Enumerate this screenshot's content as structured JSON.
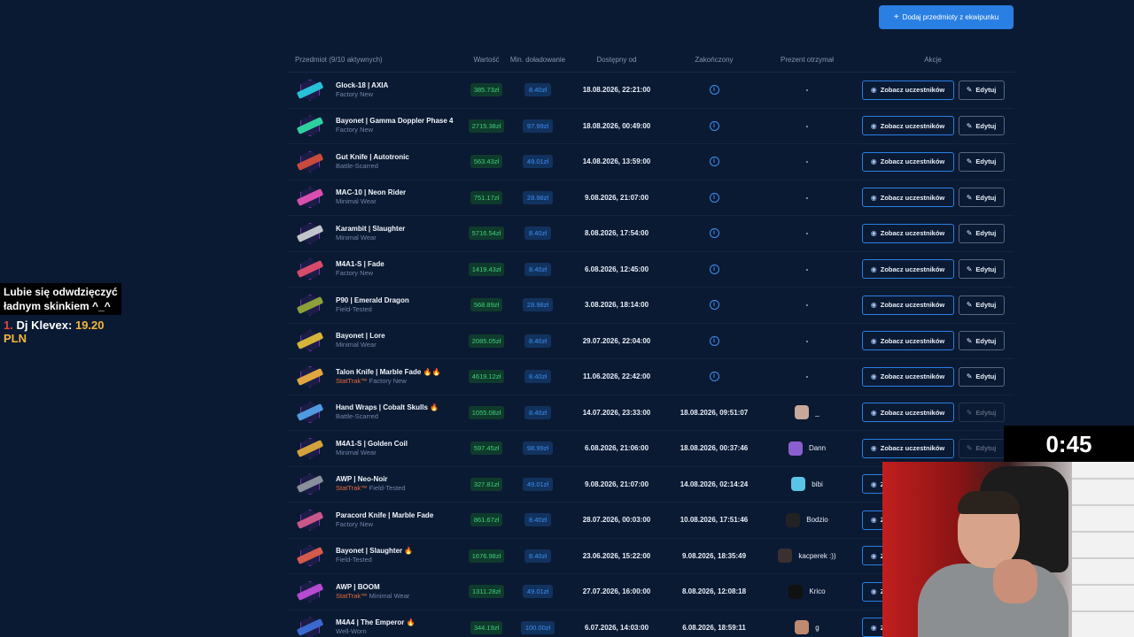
{
  "header": {
    "add_button_label": "Dodaj przedmioty z ekwipunku",
    "add_button_icon": "+"
  },
  "table": {
    "headers": {
      "item": "Przedmiot (9/10 aktywnych)",
      "value": "Wartość",
      "min_deposit": "Min. doładowanie",
      "available_from": "Dostępny od",
      "ended": "Zakończony",
      "gift_received": "Prezent otrzymał",
      "actions": "Akcje"
    },
    "view_label": "Zobacz uczestników",
    "edit_label": "Edytuj",
    "rows": [
      {
        "name": "Glock-18 | AXIA",
        "stattrak": "",
        "condition": "Factory New",
        "fire": "",
        "value": "385.73zł",
        "min": "8.40zł",
        "from": "18.08.2026, 22:21:00",
        "ended": "",
        "gift": "-",
        "gift_color": "",
        "edit_disabled": false,
        "color": "#27c0d6"
      },
      {
        "name": "Bayonet | Gamma Doppler Phase 4",
        "stattrak": "",
        "condition": "Factory New",
        "fire": "",
        "value": "2715.38zł",
        "min": "97.99zł",
        "from": "18.08.2026, 00:49:00",
        "ended": "",
        "gift": "-",
        "gift_color": "",
        "edit_disabled": false,
        "color": "#2fd0a0"
      },
      {
        "name": "Gut Knife | Autotronic",
        "stattrak": "",
        "condition": "Battle-Scarred",
        "fire": "",
        "value": "563.43zł",
        "min": "49.01zł",
        "from": "14.08.2026, 13:59:00",
        "ended": "",
        "gift": "-",
        "gift_color": "",
        "edit_disabled": false,
        "color": "#c94a3c"
      },
      {
        "name": "MAC-10 | Neon Rider",
        "stattrak": "",
        "condition": "Minimal Wear",
        "fire": "",
        "value": "751.17zł",
        "min": "28.98zł",
        "from": "9.08.2026, 21:07:00",
        "ended": "",
        "gift": "-",
        "gift_color": "",
        "edit_disabled": false,
        "color": "#d94fb0"
      },
      {
        "name": "Karambit | Slaughter",
        "stattrak": "",
        "condition": "Minimal Wear",
        "fire": "",
        "value": "5716.54zł",
        "min": "8.40zł",
        "from": "8.08.2026, 17:54:00",
        "ended": "",
        "gift": "-",
        "gift_color": "",
        "edit_disabled": false,
        "color": "#c2c6cc"
      },
      {
        "name": "M4A1-S | Fade",
        "stattrak": "",
        "condition": "Factory New",
        "fire": "",
        "value": "1419.43zł",
        "min": "8.40zł",
        "from": "6.08.2026, 12:45:00",
        "ended": "",
        "gift": "-",
        "gift_color": "",
        "edit_disabled": false,
        "color": "#d84b6a"
      },
      {
        "name": "P90 | Emerald Dragon",
        "stattrak": "",
        "condition": "Field-Tested",
        "fire": "",
        "value": "568.89zł",
        "min": "28.98zł",
        "from": "3.08.2026, 18:14:00",
        "ended": "",
        "gift": "-",
        "gift_color": "",
        "edit_disabled": false,
        "color": "#8da03a"
      },
      {
        "name": "Bayonet | Lore",
        "stattrak": "",
        "condition": "Minimal Wear",
        "fire": "",
        "value": "2085.05zł",
        "min": "8.40zł",
        "from": "29.07.2026, 22:04:00",
        "ended": "",
        "gift": "-",
        "gift_color": "",
        "edit_disabled": false,
        "color": "#d4b53a"
      },
      {
        "name": "Talon Knife | Marble Fade",
        "stattrak": "StatTrak™",
        "condition": "Factory New",
        "fire": "🔥🔥",
        "value": "4619.12zł",
        "min": "8.40zł",
        "from": "11.06.2026, 22:42:00",
        "ended": "",
        "gift": "-",
        "gift_color": "",
        "edit_disabled": false,
        "color": "#e0a640"
      },
      {
        "name": "Hand Wraps | Cobalt Skulls",
        "stattrak": "",
        "condition": "Battle-Scarred",
        "fire": "🔥",
        "value": "1055.08zł",
        "min": "8.40zł",
        "from": "14.07.2026, 23:33:00",
        "ended": "18.08.2026, 09:51:07",
        "gift": "_",
        "gift_color": "#c7a89a",
        "edit_disabled": true,
        "color": "#4f9ae0"
      },
      {
        "name": "M4A1-S | Golden Coil",
        "stattrak": "",
        "condition": "Minimal Wear",
        "fire": "",
        "value": "597.45zł",
        "min": "98.99zł",
        "from": "6.08.2026, 21:06:00",
        "ended": "18.08.2026, 00:37:46",
        "gift": "Dann",
        "gift_color": "#8a5fd0",
        "edit_disabled": true,
        "color": "#d4a23a"
      },
      {
        "name": "AWP | Neo-Noir",
        "stattrak": "StatTrak™",
        "condition": "Field-Tested",
        "fire": "",
        "value": "327.81zł",
        "min": "49.01zł",
        "from": "9.08.2026, 21:07:00",
        "ended": "14.08.2026, 02:14:24",
        "gift": "bibi",
        "gift_color": "#5ac4e8",
        "edit_disabled": false,
        "color": "#8a8f9c"
      },
      {
        "name": "Paracord Knife | Marble Fade",
        "stattrak": "",
        "condition": "Factory New",
        "fire": "",
        "value": "861.67zł",
        "min": "8.40zł",
        "from": "28.07.2026, 00:03:00",
        "ended": "10.08.2026, 17:51:46",
        "gift": "Bodzio",
        "gift_color": "#222222",
        "edit_disabled": false,
        "color": "#c9588a"
      },
      {
        "name": "Bayonet | Slaughter",
        "stattrak": "",
        "condition": "Field-Tested",
        "fire": "🔥",
        "value": "1676.98zł",
        "min": "8.40zł",
        "from": "23.06.2026, 15:22:00",
        "ended": "9.08.2026, 18:35:49",
        "gift": "kacperek :))",
        "gift_color": "#3a3030",
        "edit_disabled": false,
        "color": "#d45a4a"
      },
      {
        "name": "AWP | BOOM",
        "stattrak": "StatTrak™",
        "condition": "Minimal Wear",
        "fire": "",
        "value": "1311.28zł",
        "min": "49.01zł",
        "from": "27.07.2026, 16:00:00",
        "ended": "8.08.2026, 12:08:18",
        "gift": "Krico",
        "gift_color": "#111111",
        "edit_disabled": false,
        "color": "#b64ad0"
      },
      {
        "name": "M4A4 | The Emperor",
        "stattrak": "",
        "condition": "Well-Worn",
        "fire": "🔥",
        "value": "344.19zł",
        "min": "100.00zł",
        "from": "6.07.2026, 14:03:00",
        "ended": "6.08.2026, 18:59:11",
        "gift": "g",
        "gift_color": "#c08a70",
        "edit_disabled": false,
        "color": "#3a6ad0"
      }
    ]
  },
  "overlay": {
    "chat_line1": "Lubie się odwdzięczyć",
    "chat_line2": "ładnym skinkiem ^_^",
    "donor_rank": "1.",
    "donor_name": "Dj Klevex:",
    "donor_amount": "19.20 PLN",
    "timer": "0:45"
  },
  "icons": {
    "info": "info-icon",
    "eye": "eye-icon",
    "edit": "edit-icon"
  }
}
